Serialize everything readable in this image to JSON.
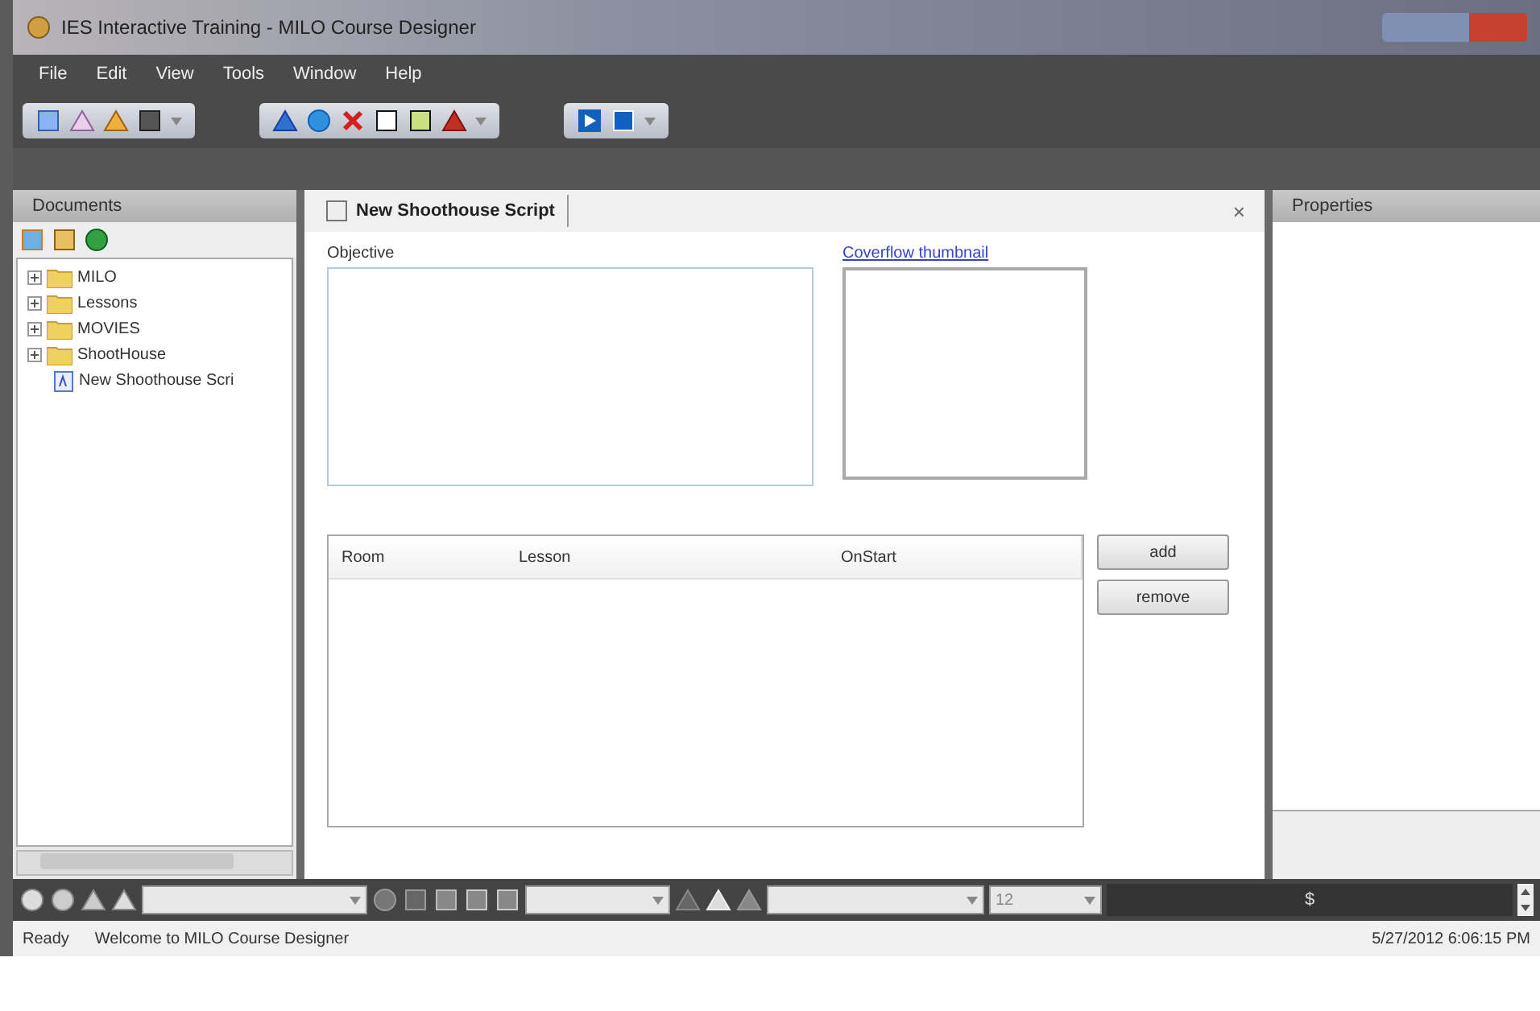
{
  "window": {
    "title": "IES Interactive Training - MILO Course Designer"
  },
  "menu": [
    "File",
    "Edit",
    "View",
    "Tools",
    "Window",
    "Help"
  ],
  "documents": {
    "title": "Documents",
    "tree": [
      {
        "label": "MILO",
        "kind": "folder",
        "expanded": false
      },
      {
        "label": "Lessons",
        "kind": "folder",
        "expanded": false
      },
      {
        "label": "MOVIES",
        "kind": "folder",
        "expanded": false
      },
      {
        "label": "ShootHouse",
        "kind": "folder",
        "expanded": false
      },
      {
        "label": "New Shoothouse Scri",
        "kind": "file"
      }
    ]
  },
  "editor": {
    "tab": "New Shoothouse Script",
    "close": "×",
    "objective_label": "Objective",
    "thumbnail_link": "Coverflow thumbnail",
    "table": {
      "columns": [
        "Room",
        "Lesson",
        "OnStart"
      ]
    },
    "buttons": [
      "add",
      "remove"
    ]
  },
  "properties": {
    "title": "Properties"
  },
  "format_bar": {
    "font_size": "12",
    "currency": "$"
  },
  "status_bar": {
    "state": "Ready",
    "message": "Welcome to MILO Course Designer",
    "datetime": "5/27/2012 6:06:15 PM"
  }
}
